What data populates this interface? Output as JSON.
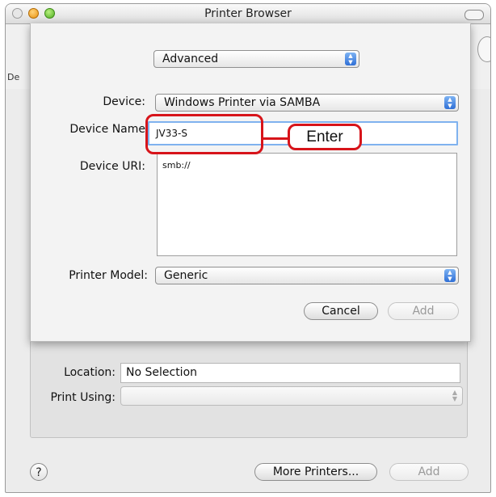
{
  "window": {
    "title": "Printer Browser"
  },
  "background": {
    "partial_label": "De",
    "location_label": "Location:",
    "location_value": "No Selection",
    "print_using_label": "Print Using:",
    "help_label": "?",
    "more_printers_label": "More Printers...",
    "add_label": "Add"
  },
  "sheet": {
    "mode_select": "Advanced",
    "device_label": "Device:",
    "device_value": "Windows Printer via SAMBA",
    "device_name_label": "Device Name",
    "device_name_value": "JV33-S",
    "device_uri_label": "Device URI:",
    "device_uri_value": "smb://",
    "printer_model_label": "Printer Model:",
    "printer_model_value": "Generic",
    "cancel_label": "Cancel",
    "add_label": "Add"
  },
  "annotation": {
    "label": "Enter",
    "color": "#d7141a"
  },
  "colors": {
    "focus_ring": "#7fb2ef",
    "popup_arrow": "#2f6fd6"
  },
  "icons": [
    "help-icon",
    "popup-arrows-icon"
  ]
}
